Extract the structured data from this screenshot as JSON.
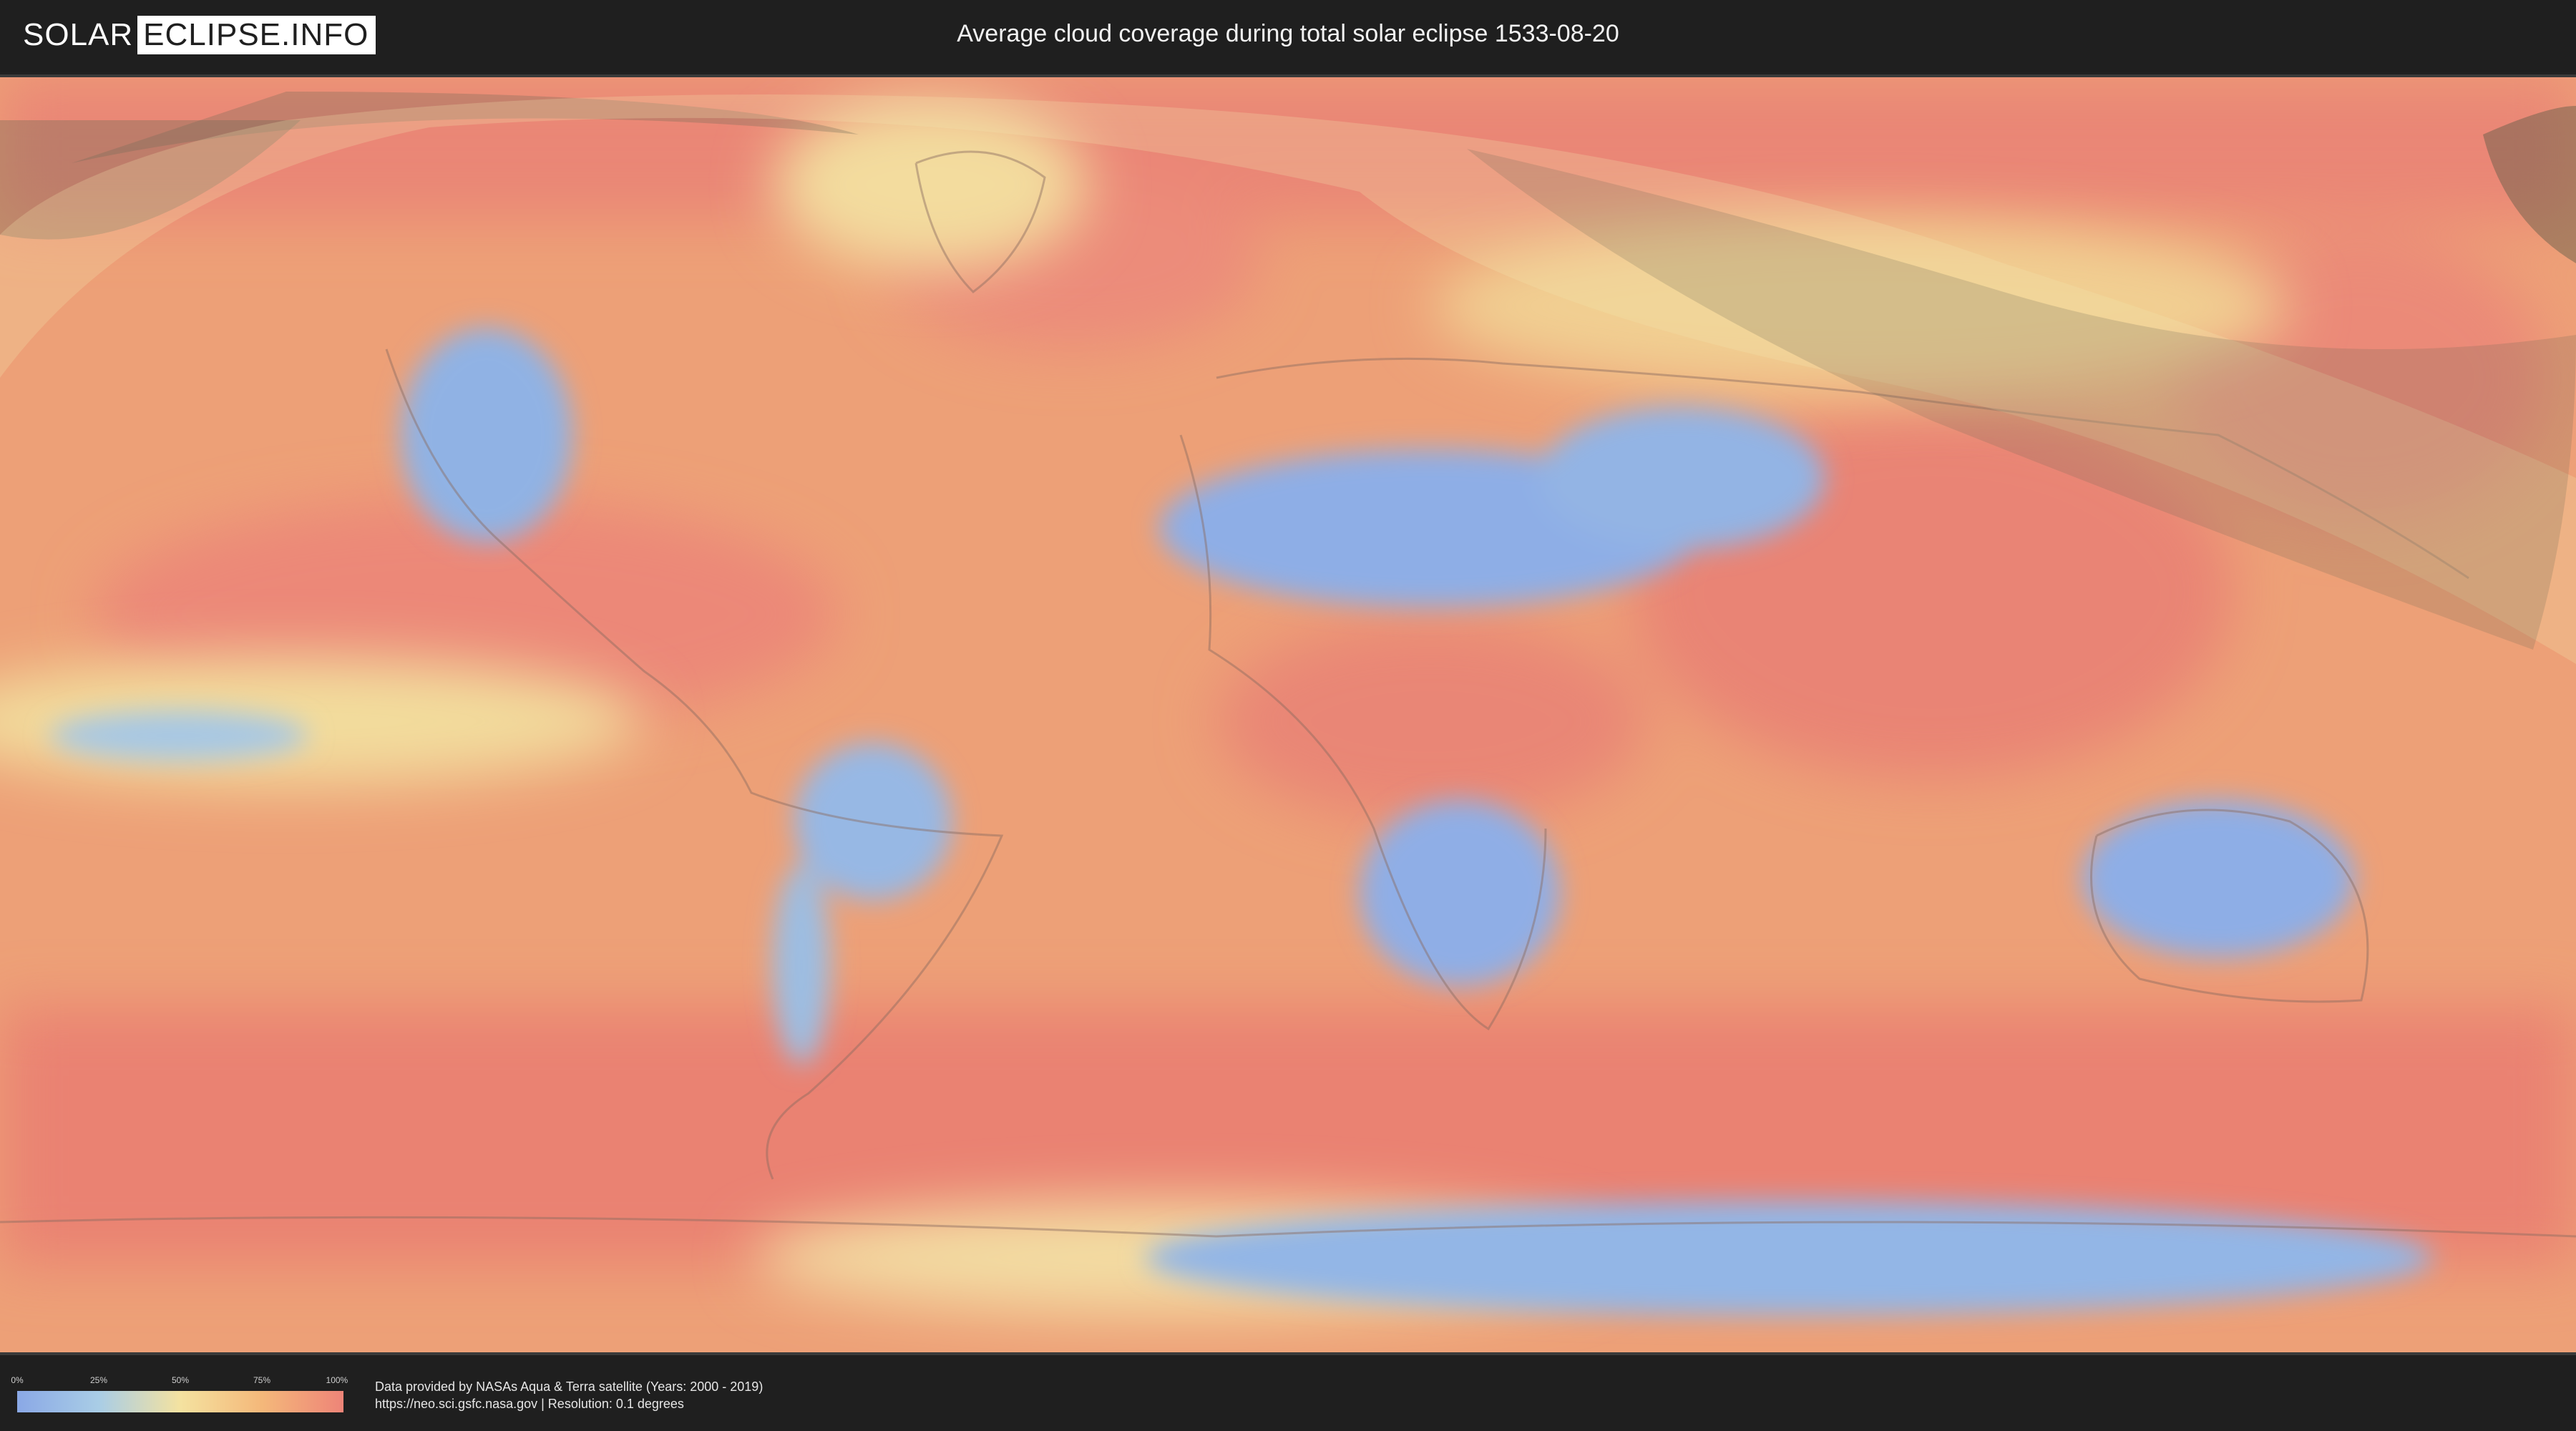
{
  "header": {
    "logo_left": "SOLAR",
    "logo_right": "ECLIPSE.INFO",
    "title": "Average cloud coverage during total solar eclipse 1533-08-20"
  },
  "map": {
    "ocean_color": "#e8a070",
    "clear_color": "#8ab0e6",
    "cloudy_color": "#ec8476",
    "shadow_color": "#6e6a55"
  },
  "legend": {
    "ticks": [
      "0%",
      "25%",
      "50%",
      "75%",
      "100%"
    ],
    "colors": [
      "#8aa8e6",
      "#a9cde6",
      "#f4e2a0",
      "#f4b87a",
      "#ee8478"
    ]
  },
  "credits": {
    "line1": "Data provided by NASAs Aqua & Terra satellite (Years: 2000 - 2019)",
    "line2": "https://neo.sci.gsfc.nasa.gov | Resolution: 0.1 degrees"
  }
}
